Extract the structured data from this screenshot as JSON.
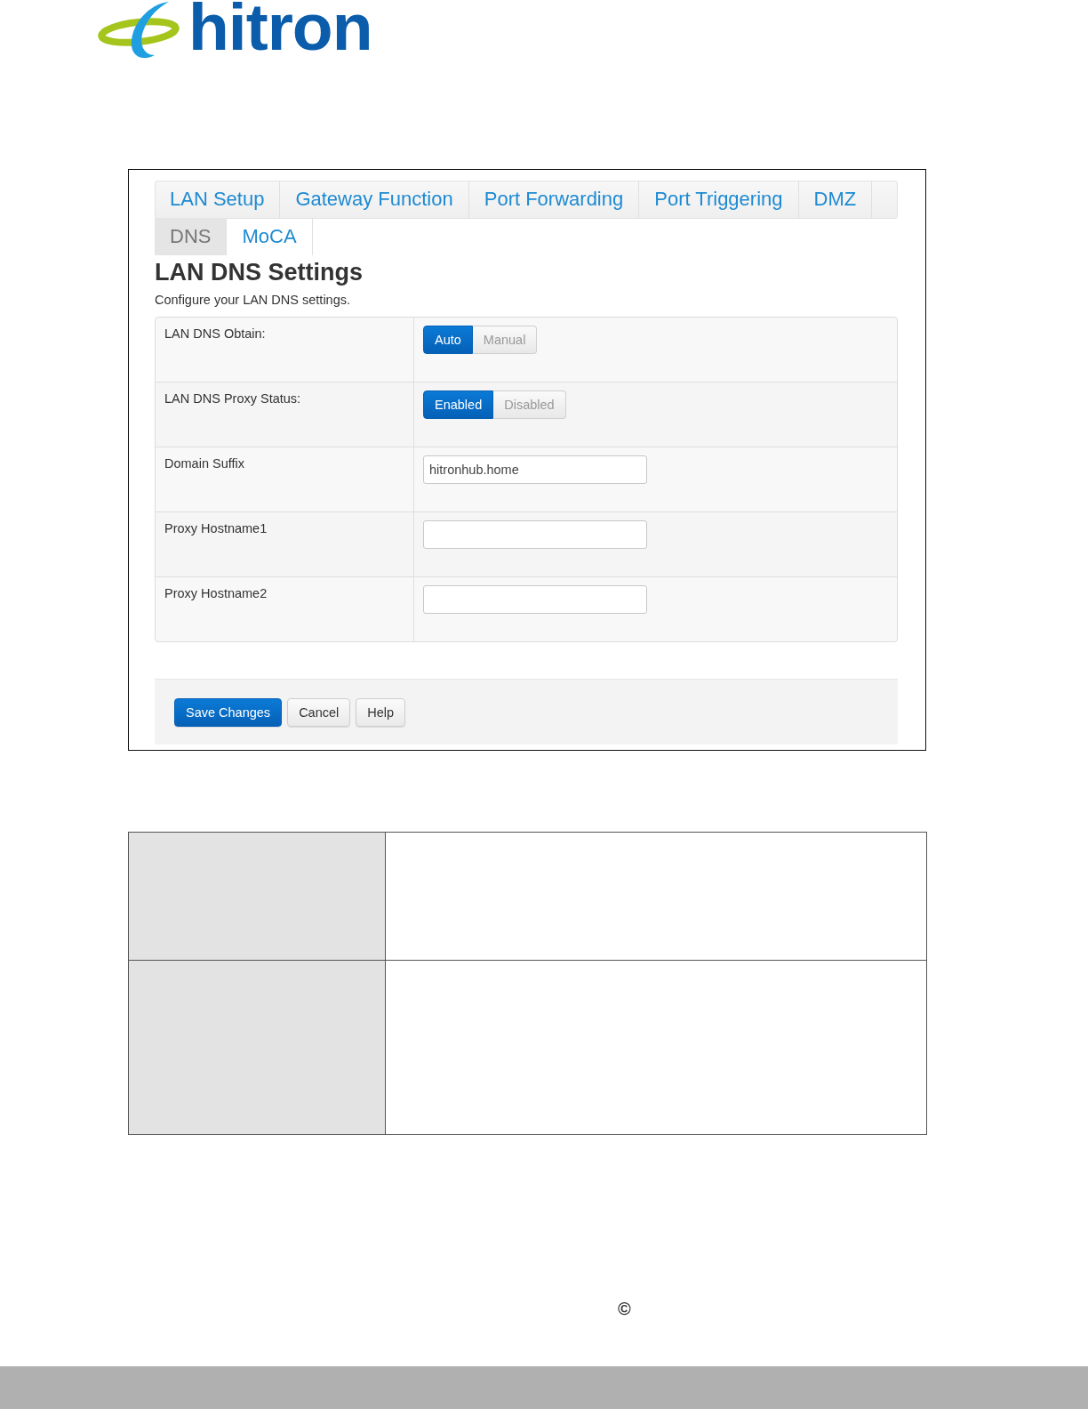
{
  "logo": {
    "text": "hitron"
  },
  "screenshot": {
    "tabs": [
      {
        "label": "LAN Setup",
        "selected": false
      },
      {
        "label": "Gateway Function",
        "selected": false
      },
      {
        "label": "Port Forwarding",
        "selected": false
      },
      {
        "label": "Port Triggering",
        "selected": false
      },
      {
        "label": "DMZ",
        "selected": false
      },
      {
        "label": "DNS",
        "selected": true
      },
      {
        "label": "MoCA",
        "selected": false
      }
    ],
    "heading": "LAN DNS Settings",
    "description": "Configure your LAN DNS settings.",
    "fields": [
      {
        "label": "LAN DNS Obtain:",
        "kind": "toggle",
        "options": [
          {
            "label": "Auto",
            "selected": true
          },
          {
            "label": "Manual",
            "selected": false
          }
        ]
      },
      {
        "label": "LAN DNS Proxy Status:",
        "kind": "toggle",
        "options": [
          {
            "label": "Enabled",
            "selected": true
          },
          {
            "label": "Disabled",
            "selected": false
          }
        ]
      },
      {
        "label": "Domain Suffix",
        "kind": "text",
        "value": "hitronhub.home"
      },
      {
        "label": "Proxy Hostname1",
        "kind": "text"
      },
      {
        "label": "Proxy Hostname2",
        "kind": "text"
      }
    ],
    "buttons": [
      {
        "label": "Save Changes",
        "kind": "primary"
      },
      {
        "label": "Cancel",
        "kind": "default"
      },
      {
        "label": "Help",
        "kind": "default"
      }
    ]
  },
  "footer": {
    "copyright": "©"
  }
}
